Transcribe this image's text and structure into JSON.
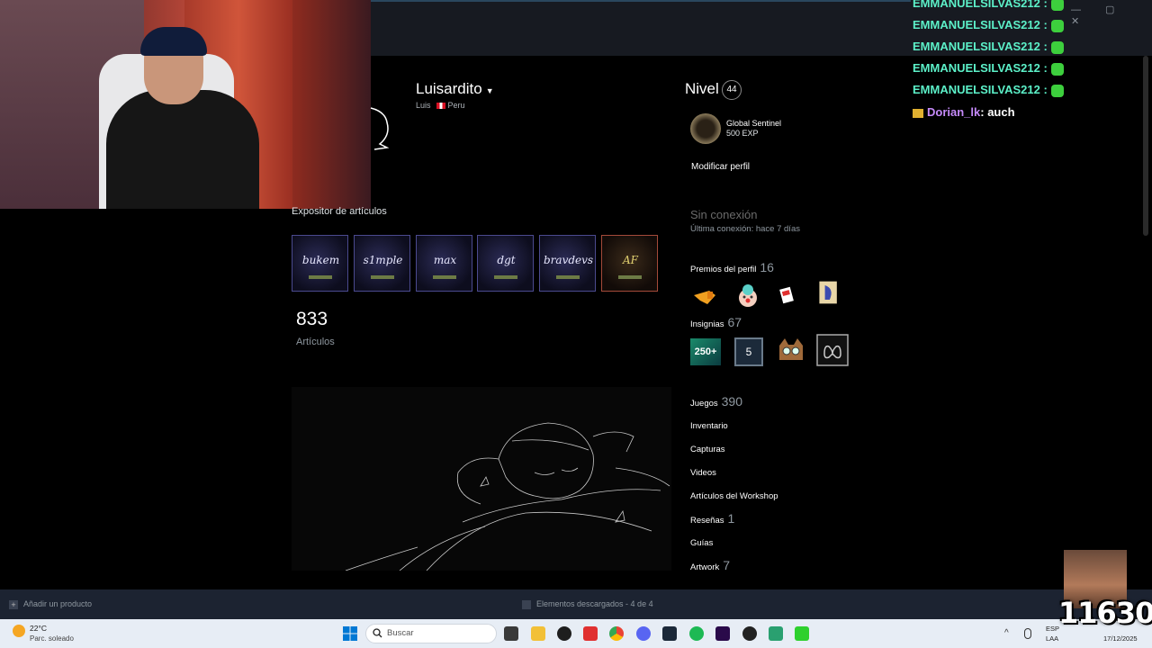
{
  "window": {
    "account_name": "Luisardito",
    "controls": "— ▢ ✕"
  },
  "chat": [
    {
      "user": "EMMANUELSILVAS212",
      "message": ":"
    },
    {
      "user": "EMMANUELSILVAS212",
      "message": ":"
    },
    {
      "user": "EMMANUELSILVAS212",
      "message": ":"
    },
    {
      "user": "EMMANUELSILVAS212",
      "message": ":"
    },
    {
      "user": "EMMANUELSILVAS212",
      "message": ":"
    }
  ],
  "chat_last": {
    "user": "Dorian_lk",
    "message": ": auch"
  },
  "profile": {
    "name": "Luisardito",
    "caret": "▼",
    "real_name": "Luis",
    "country": "Peru",
    "level_label": "Nivel",
    "level": "44",
    "badge_name": "Global Sentinel",
    "badge_xp": "500 EXP",
    "edit_label": "Modificar perfil",
    "status": "Sin conexión",
    "last_online": "Última conexión: hace 7 días",
    "awards_label": "Premios del perfil",
    "awards_count": "16",
    "badges_label": "Insignias",
    "badges_count": "67",
    "badge_250": "250+",
    "badge_5": "5"
  },
  "showcase": {
    "title": "Expositor de artículos",
    "items": [
      "bukem",
      "s1mple",
      "max",
      "dgt",
      "bravdevs",
      "AF"
    ],
    "count": "833",
    "count_label": "Artículos"
  },
  "links": {
    "games_label": "Juegos",
    "games_count": "390",
    "inventory": "Inventario",
    "screenshots": "Capturas",
    "videos": "Videos",
    "workshop": "Artículos del Workshop",
    "reviews_label": "Reseñas",
    "reviews_count": "1",
    "guides": "Guías",
    "artwork_label": "Artwork",
    "artwork_count": "7"
  },
  "bottombar": {
    "add_product": "Añadir un producto",
    "downloads": "Elementos descargados - 4 de 4"
  },
  "taskbar": {
    "weather_temp": "22°C",
    "weather_desc": "Parc. soleado",
    "search_placeholder": "Buscar",
    "lang_1": "ESP",
    "lang_2": "LAA",
    "date": "17/12/2025"
  },
  "overlay": {
    "count": "11630"
  },
  "colors": {
    "accent": "#5cf0c8",
    "steam_dark": "#171a21",
    "bar": "#1c2331",
    "taskbar": "#e7edf5"
  }
}
